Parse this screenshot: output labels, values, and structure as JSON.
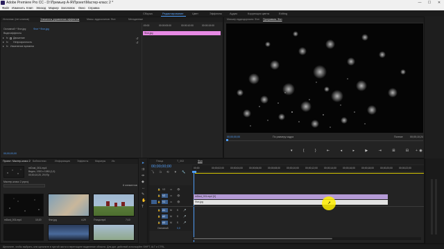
{
  "window": {
    "title": "Adobe Premiere Pro CC - D:\\Премьер А-Я\\Проект\\Мастер-класс 2 *",
    "min": "—",
    "max": "☐",
    "close": "✕"
  },
  "menu": [
    "Файл",
    "Изменить",
    "Клип",
    "Эпизод",
    "Маркер",
    "Заголовок",
    "Окно",
    "Справка"
  ],
  "workspaces": [
    {
      "label": "Сборка",
      "active": false
    },
    {
      "label": "Редактирование",
      "active": true
    },
    {
      "label": "Цвет",
      "active": false
    },
    {
      "label": "Эффекты",
      "active": false
    },
    {
      "label": "Аудио",
      "active": false
    },
    {
      "label": "Коррекция цвета",
      "active": false
    },
    {
      "label": "Editing",
      "active": false
    }
  ],
  "top_left_panel": {
    "tabs": [
      "Источник: (нет клипов)",
      "Элементы управления эффектом",
      "Микш. аудиоклипов: Фон",
      "Метаданные"
    ],
    "breadcrumb_main": "Основной * Фон.jpg",
    "breadcrumb_seq": "Фон * Фон.jpg",
    "section": "Видеоэффекты",
    "rows": [
      "Движение",
      "Непрозрачность",
      "Изменение времени"
    ],
    "timecodes": [
      ":00:00",
      "00:00:05:00",
      "00:00:10:00",
      "00:00:15:00"
    ],
    "clip_label": "Фон.jpg",
    "bottom_timecode": "00;00;00;00"
  },
  "program_panel": {
    "tabs": [
      "Микшер аудиодорожек: Фон",
      "Программа: Фон"
    ],
    "timecode_left": "00;00;00;00",
    "fit": "По размеру кадра",
    "quality": "Полное",
    "timecode_right": "00;00;10;24",
    "controls": [
      "▼",
      "{",
      "}",
      "|◀",
      "◀|",
      "▶",
      "|▶",
      "▶|",
      "⊞",
      "⊟",
      "📷",
      "+"
    ]
  },
  "project_panel": {
    "tabs": [
      "Проект: Мастер-класс 2",
      "Библиотеки",
      "Информация",
      "Эффекты",
      "Маркеры",
      "Ис"
    ],
    "file_name": "mDust_001.mp4",
    "file_info1": "Видео, 1920 x 1080 (1,0)",
    "file_info2": "00;00;10;20, 29,97p",
    "folder": "Мастер-класс 2.prproj",
    "count": "8 элементов",
    "items": [
      {
        "name": "mDust_001.mp4",
        "dur": "10;20"
      },
      {
        "name": "Фон.jpg",
        "dur": "4;29"
      },
      {
        "name": "Птица.mp4",
        "dur": "7;10"
      }
    ]
  },
  "timeline": {
    "tabs": [
      "Птица",
      "T_002",
      "Фон"
    ],
    "timecode": "00;00;00;00",
    "ruler": [
      "00;00",
      "00;00;02;00",
      "00;00;04;00",
      "00;00;06;00",
      "00;00;08;00",
      "00;00;10;00",
      "00;00;12;00",
      "00;00;14;00",
      "00;00;16;00",
      "00;00;18;00",
      "00;00;20;00",
      "00;00;22;00"
    ],
    "tracks": [
      "V3",
      "V2",
      "V1",
      "A1",
      "A2",
      "A3",
      "Основной"
    ],
    "master_value": "0,0",
    "clip_v2": "mDust_001.mp4 [V]",
    "clip_v1": "Фон.jpg"
  },
  "status": "Щелкните, чтобы выбрать, или щелкните в пустой части и перетащите выделение области. Для доп. действий используйте SHIFT, ALT и CTRL.",
  "colors": {
    "accent": "#4f9cf5",
    "clip": "#b59bd6",
    "clip_v1": "#e2e2e2",
    "cursor": "#fff000",
    "pink": "#e78ae5"
  }
}
